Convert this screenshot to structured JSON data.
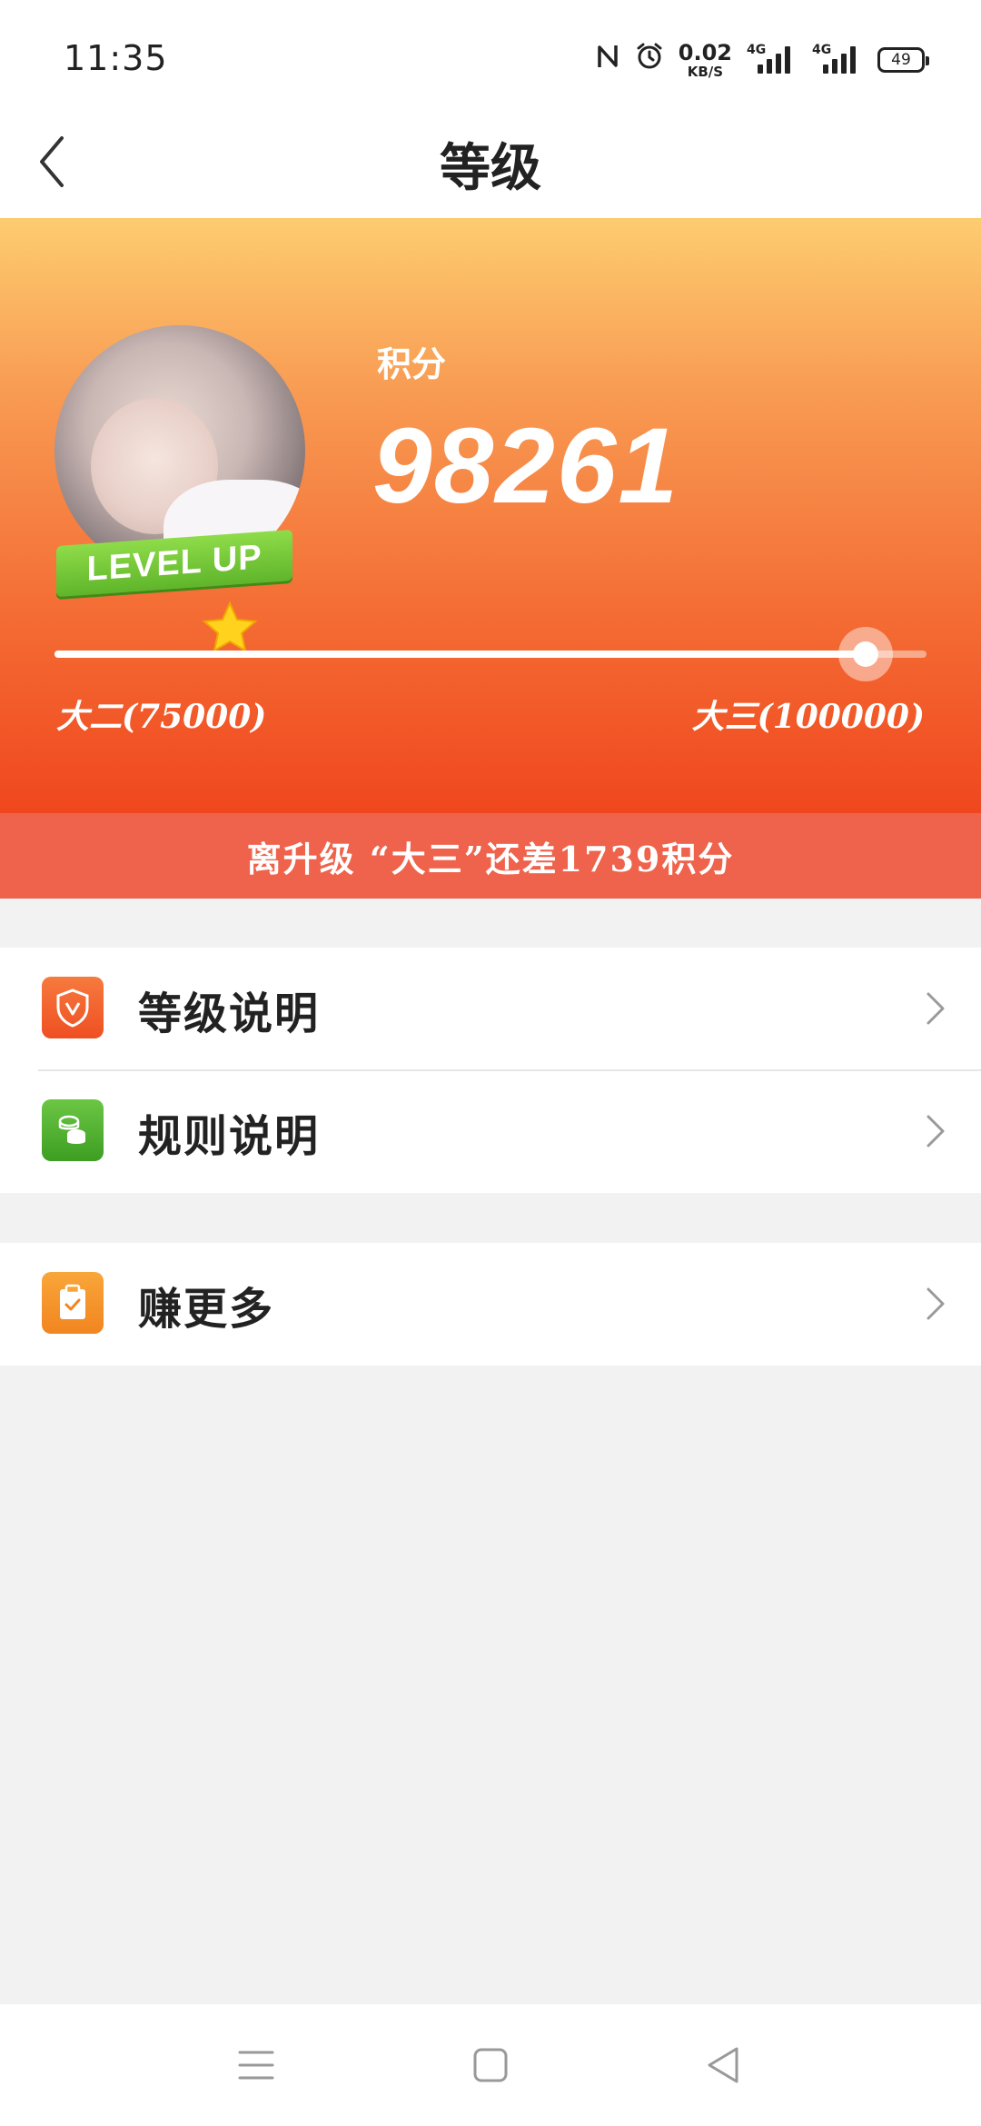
{
  "status_bar": {
    "time": "11:35",
    "nfc_icon": "nfc-icon",
    "alarm_icon": "alarm-icon",
    "net_speed_value": "0.02",
    "net_speed_unit": "KB/S",
    "signal_1_tag": "4G",
    "signal_2_tag": "4G",
    "battery": "49"
  },
  "header": {
    "title": "等级",
    "back_icon": "chevron-left-icon"
  },
  "hero": {
    "points_label": "积分",
    "points_value": "98261",
    "level_badge_text": "LEVEL UP",
    "current_level": "大二(75000)",
    "next_level": "大三(100000)",
    "progress": 0.93,
    "upgrade_message": "离升级 “大三”还差1739积分"
  },
  "menu": {
    "group1": [
      {
        "label": "等级说明",
        "icon": "shield-v-icon",
        "color": "#f05a2a"
      },
      {
        "label": "规则说明",
        "icon": "coins-icon",
        "color": "#4fb233"
      }
    ],
    "group2": [
      {
        "label": "赚更多",
        "icon": "clipboard-check-icon",
        "color": "#f5962a"
      }
    ]
  },
  "nav": {
    "menu_icon": "menu-icon",
    "home_icon": "home-square-icon",
    "back_icon": "back-triangle-icon"
  },
  "colors": {
    "hero_top": "#fdcc70",
    "hero_bottom": "#f0471e",
    "banner": "#ef624b",
    "background": "#f2f2f2"
  }
}
